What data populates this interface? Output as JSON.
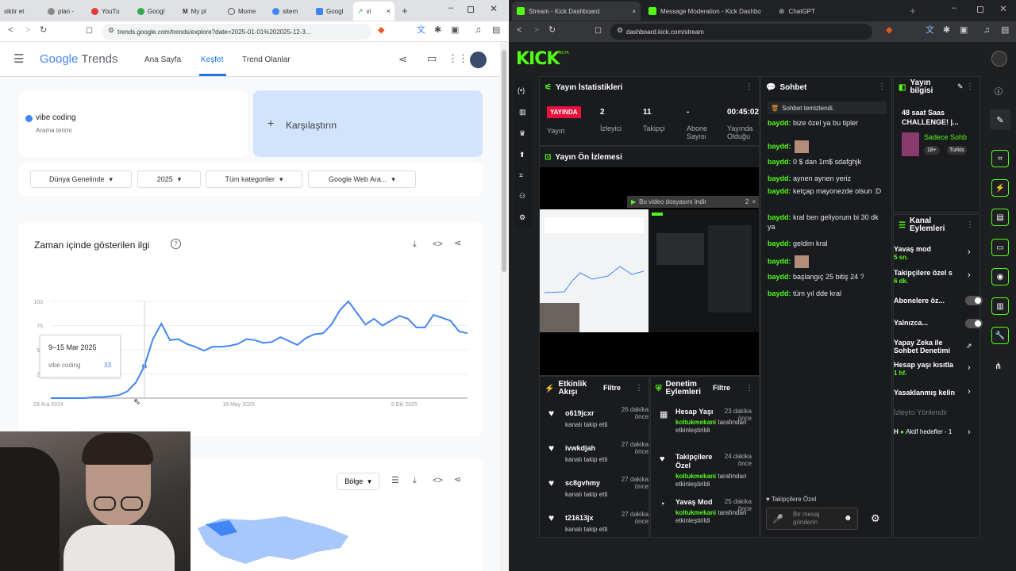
{
  "left_browser": {
    "tabs": [
      {
        "label": "siktir et"
      },
      {
        "label": "plan -"
      },
      {
        "label": "YouTu"
      },
      {
        "label": "Googl"
      },
      {
        "label": "My pl"
      },
      {
        "label": "Mome"
      },
      {
        "label": "sitem"
      },
      {
        "label": "Googl"
      },
      {
        "label": "vi"
      }
    ],
    "new_tab": "+",
    "url": "trends.google.com/trends/explore?date=2025-01-01%202025-12-3...",
    "nav": {
      "menu": "☰",
      "logo_google": "Google",
      "logo_trends": "Trends",
      "home": "Ana Sayfa",
      "explore": "Keşfet",
      "trending": "Trend Olanlar"
    },
    "term": {
      "name": "vibe coding",
      "subtitle": "Arama terimi",
      "color": "#4285f4"
    },
    "compare": {
      "plus": "+",
      "label": "Karşılaştırın"
    },
    "filters": {
      "region": "Dünya Genelinde",
      "year": "2025",
      "category": "Tüm kategoriler",
      "search_type": "Google Web Ara..."
    },
    "interest_card": {
      "title": "Zaman içinde gösterilen ilgi",
      "help": "?"
    },
    "tooltip": {
      "date": "9–15 Mar 2025",
      "term": "vibe coding",
      "value": "33"
    },
    "region_card": {
      "select": "Bölge"
    }
  },
  "chart_data": {
    "type": "line",
    "x_ticks": [
      "29 Ara 2024",
      "18 May 2025",
      "5 Eki 2025"
    ],
    "y_ticks": [
      "100",
      "75",
      "50",
      "25"
    ],
    "ylim": [
      0,
      100
    ],
    "series": [
      {
        "values": [
          0,
          0,
          0,
          0,
          0,
          1,
          1,
          2,
          3,
          7,
          16,
          33,
          61,
          77,
          60,
          61,
          56,
          53,
          49,
          53,
          53,
          54,
          56,
          61,
          60,
          57,
          58,
          63,
          59,
          55,
          62,
          66,
          67,
          76,
          91,
          100,
          88,
          76,
          82,
          75,
          80,
          85,
          82,
          73,
          73,
          86,
          83,
          80,
          69,
          67
        ],
        "color": "#4285f4"
      }
    ]
  },
  "right_browser": {
    "tabs": [
      {
        "label": "Stream - Kick Dashboard"
      },
      {
        "label": "Message Moderation - Kick Dashbo"
      },
      {
        "label": "ChatGPT"
      }
    ],
    "url": "dashboard.kick.com/stream",
    "logo": "KICK",
    "logo_badge": "BETA",
    "stats": {
      "title": "Yayın İstatistikleri",
      "live_badge": "YAYINDA",
      "live_label": "Yayın",
      "viewers_value": "2",
      "viewers_label": "İzleyici",
      "followers_value": "11",
      "followers_label": "Takipçi",
      "subs_value": "-",
      "subs_label": "Abone Sayısı",
      "uptime_value": "00:45:02",
      "uptime_label": "Yayında Olduğu"
    },
    "preview": {
      "title": "Yayın Ön İzlemesi",
      "download_bar": "Bu video dosyasını indir",
      "download_count": "2"
    },
    "activity": {
      "title": "Etkinlik Akışı",
      "filter": "Filtre",
      "items": [
        {
          "user": "o619jcxr",
          "time": "26 dakika önce",
          "action": "kanalı takip etti"
        },
        {
          "user": "ivwkdjah",
          "time": "27 dakika önce",
          "action": "kanalı takip etti"
        },
        {
          "user": "sc8gvhmy",
          "time": "27 dakika önce",
          "action": "kanalı takip etti"
        },
        {
          "user": "t21613jx",
          "time": "27 dakika önce",
          "action": "kanalı takip etti"
        }
      ]
    },
    "moderation": {
      "title": "Denetim Eylemleri",
      "filter": "Filtre",
      "items": [
        {
          "action": "Hesap Yaşı",
          "time": "23 dakika önce",
          "by": "koltukmekani",
          "by_suffix": "tarafından etkinleştirildi"
        },
        {
          "action": "Takipçilere Özel",
          "time": "24 dakika önce",
          "by": "koltukmekani",
          "by_suffix": "tarafından etkinleştirildi"
        },
        {
          "action": "Yavaş Mod",
          "time": "25 dakika önce",
          "by": "koltukmekani",
          "by_suffix": "tarafından etkinleştirildi"
        }
      ]
    },
    "chat": {
      "title": "Sohbet",
      "cleared": "Sohbet temizlendi.",
      "messages": [
        {
          "user": "baydd:",
          "text": "bize özel ya bu tipler"
        },
        {
          "user": "baydd:",
          "text": ""
        },
        {
          "user": "baydd:",
          "text": "0 $ dan 1m$ sdafghjk"
        },
        {
          "user": "baydd:",
          "text": "aynen aynen yeriz"
        },
        {
          "user": "baydd:",
          "text": "ketçap mayonezde olsun :D"
        },
        {
          "user": "baydd:",
          "text": "kral ben geliyorum bi 30 dk ya"
        },
        {
          "user": "baydd:",
          "text": "geldim kral"
        },
        {
          "user": "baydd:",
          "text": ""
        },
        {
          "user": "baydd:",
          "text": "başlangıç 25 bitiş 24 ?"
        },
        {
          "user": "baydd:",
          "text": "tüm yıl dde kral"
        }
      ],
      "mode": "Takipçilere Özel",
      "input_placeholder": "Bir mesaj gönderin"
    },
    "stream_info": {
      "title": "Yayın bilgisi",
      "stream_title": "48 saat Saas CHALLENGE! |...",
      "category": "Sadece Sohb",
      "age_badge": "18+",
      "lang_badge": "Turkis"
    },
    "channel_actions": {
      "title": "Kanal Eylemleri",
      "slow_mode": "Yavaş mod",
      "slow_mode_value": "5 sn.",
      "followers_only": "Takipçilere özel s",
      "followers_only_value": "6 dk.",
      "subs_only": "Abonelere öz...",
      "only": "Yalnızca...",
      "ai_moderation": "Yapay Zeka ile Sohbet Denetimi",
      "account_age": "Hesap yaşı kısıtla",
      "account_age_value": "1 hf.",
      "banned": "Yasaklanmış kelin",
      "raid": "İzleyici Yönlendir",
      "goals_prefix": "H",
      "goals": "Aktif hedefler - 1"
    },
    "colors": {
      "kick_green": "#53fc18",
      "live_red": "#e9113c",
      "dark_bg": "#1d1f21"
    }
  }
}
